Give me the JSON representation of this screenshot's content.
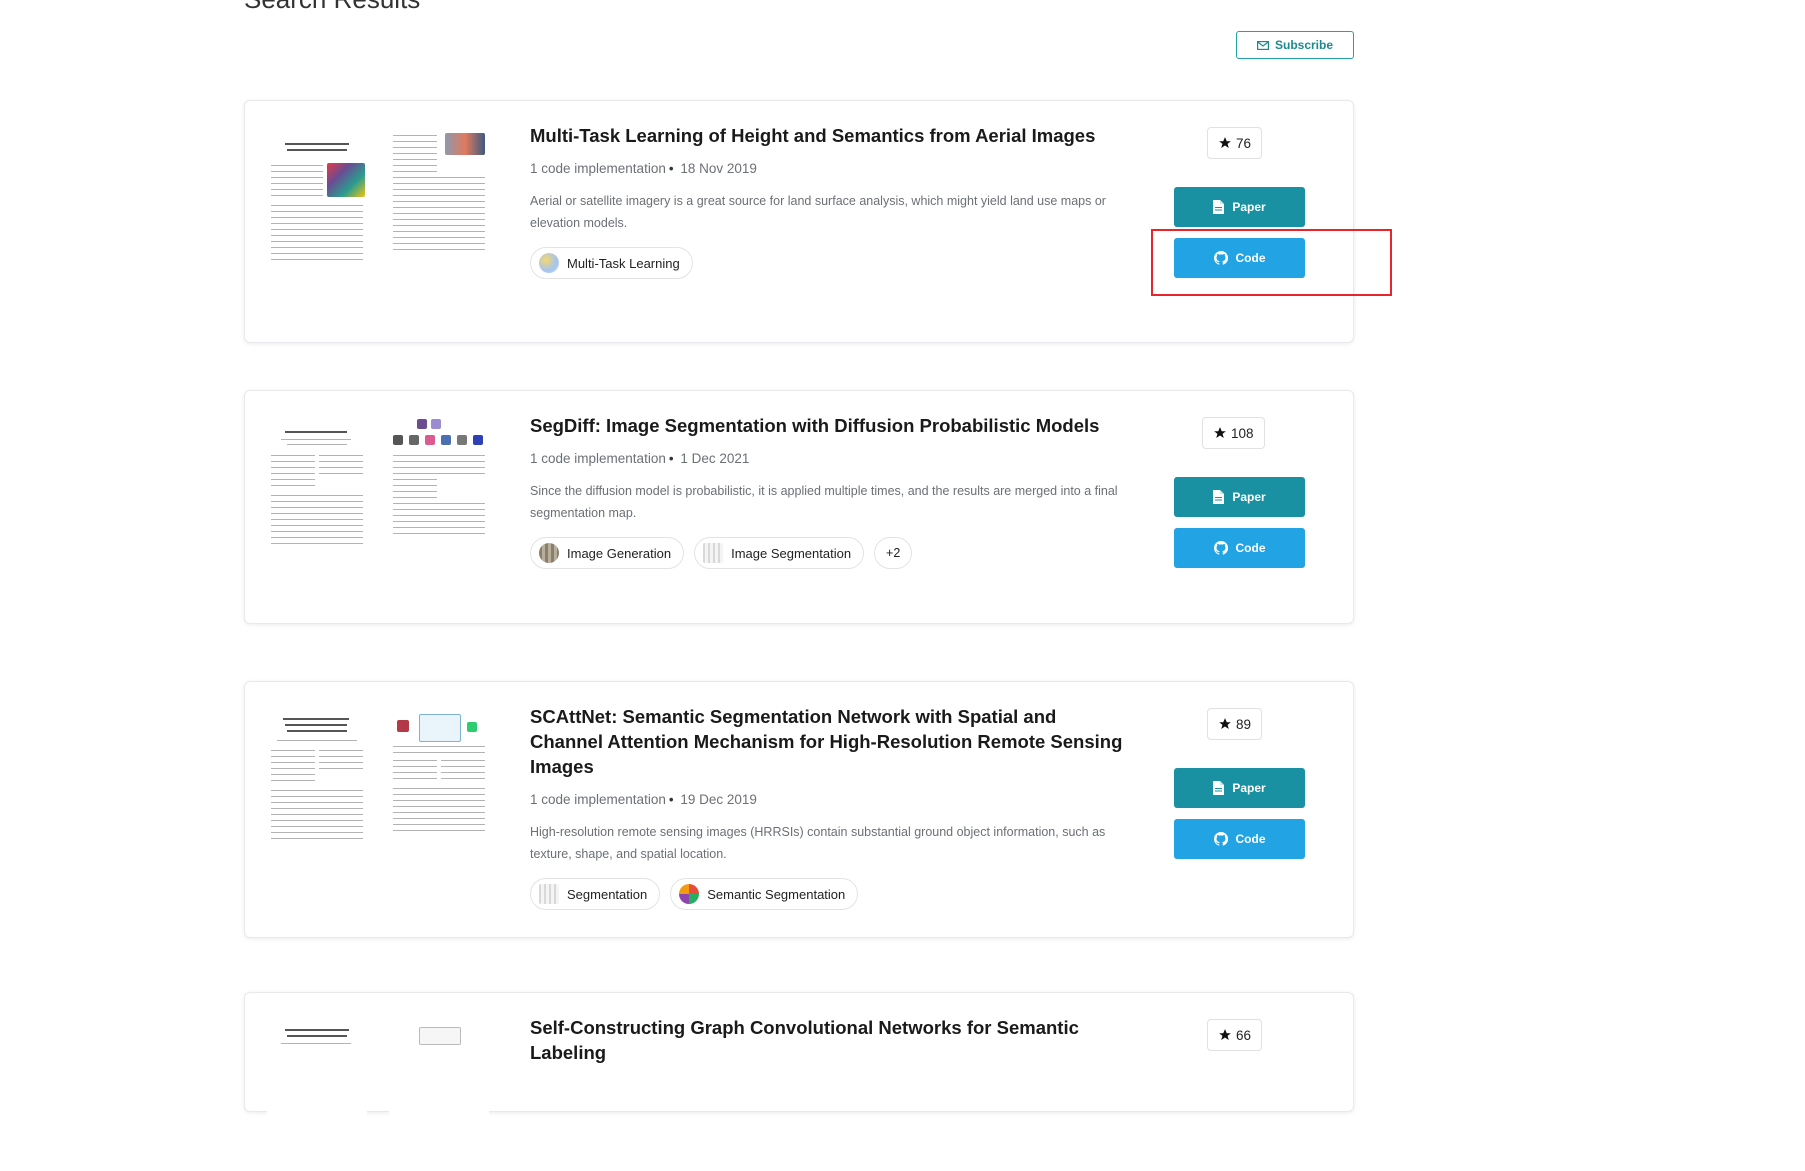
{
  "page": {
    "heading": "Search Results",
    "subscribe_label": "Subscribe"
  },
  "results": [
    {
      "title": "Multi-Task Learning of Height and Semantics from Aerial Images",
      "implementations": "1 code implementation",
      "date": "18 Nov 2019",
      "abstract": "Aerial or satellite imagery is a great source for land surface analysis, which might yield land use maps or elevation models.",
      "tasks": [
        "Multi-Task Learning"
      ],
      "stars": "76",
      "paper_label": "Paper",
      "code_label": "Code"
    },
    {
      "title": "SegDiff: Image Segmentation with Diffusion Probabilistic Models",
      "implementations": "1 code implementation",
      "date": "1 Dec 2021",
      "abstract": "Since the diffusion model is probabilistic, it is applied multiple times, and the results are merged into a final segmentation map.",
      "tasks": [
        "Image Generation",
        "Image Segmentation"
      ],
      "more_tasks": "+2",
      "stars": "108",
      "paper_label": "Paper",
      "code_label": "Code"
    },
    {
      "title": "SCAttNet: Semantic Segmentation Network with Spatial and Channel Attention Mechanism for High-Resolution Remote Sensing Images",
      "implementations": "1 code implementation",
      "date": "19 Dec 2019",
      "abstract": "High-resolution remote sensing images (HRRSIs) contain substantial ground object information, such as texture, shape, and spatial location.",
      "tasks": [
        "Segmentation",
        "Semantic Segmentation"
      ],
      "stars": "89",
      "paper_label": "Paper",
      "code_label": "Code"
    },
    {
      "title": "Self-Constructing Graph Convolutional Networks for Semantic Labeling",
      "stars": "66"
    }
  ],
  "icons": {
    "star": "star-icon",
    "paper": "file-text-icon",
    "code": "github-icon",
    "subscribe": "envelope-icon"
  },
  "colors": {
    "paper_button": "#1a90a3",
    "code_button": "#21a3e4",
    "highlight_box": "#e8252b"
  }
}
